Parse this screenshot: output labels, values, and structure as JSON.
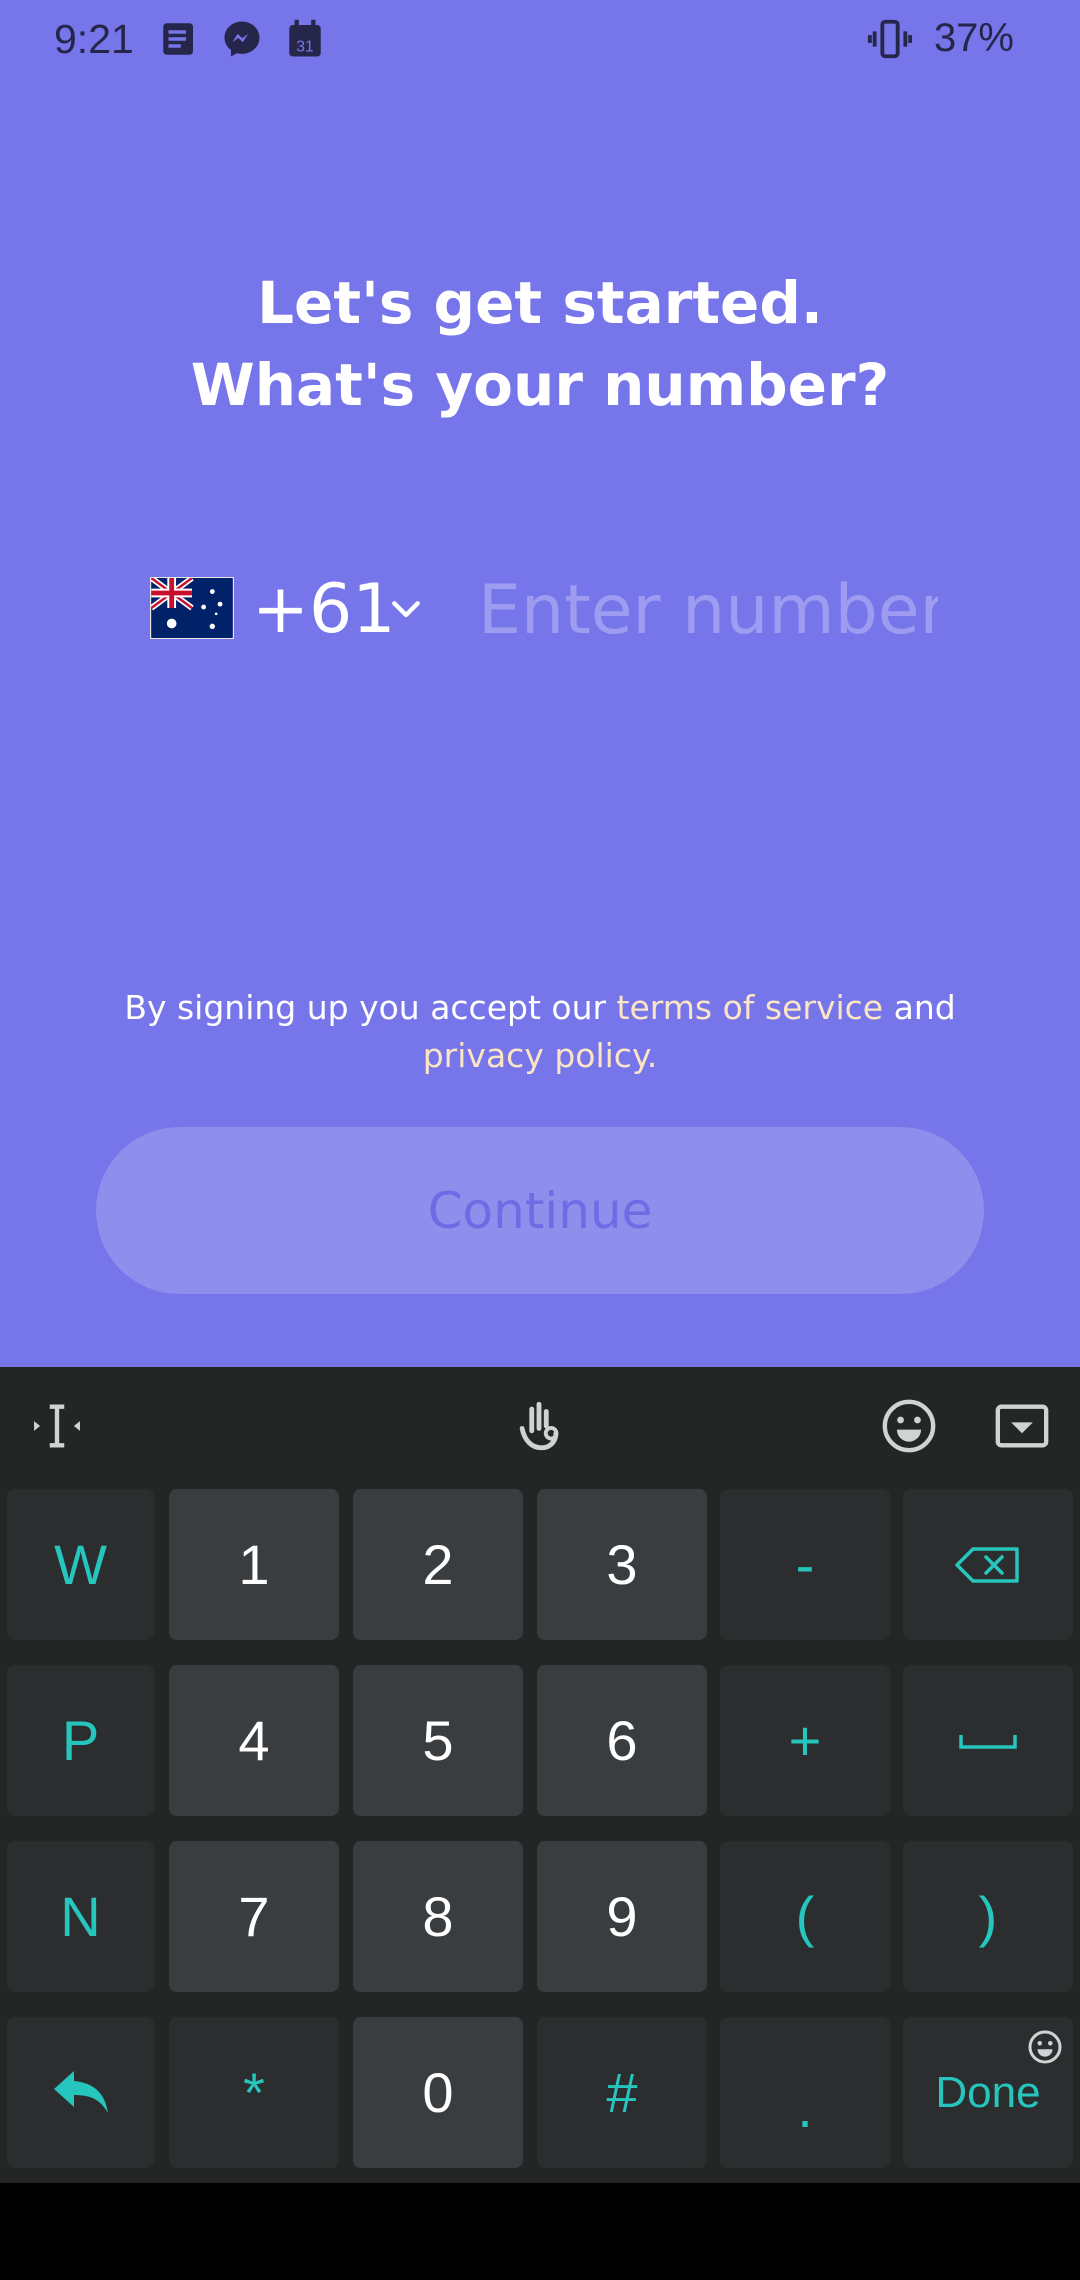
{
  "status_bar": {
    "time": "9:21",
    "battery": "37%",
    "icons": [
      "news-icon",
      "messenger-icon",
      "calendar-icon",
      "vibrate-icon"
    ],
    "calendar_day": "31"
  },
  "headline": {
    "line1": "Let's get started.",
    "line2": "What's your number?"
  },
  "phone": {
    "country_flag": "australia-flag",
    "country_code": "+61",
    "placeholder": "Enter number",
    "value": ""
  },
  "terms": {
    "prefix": "By signing up you accept our ",
    "tos_link": "terms of service",
    "middle": " and",
    "privacy_link": "privacy policy.",
    "link_color": "#fbe5c4"
  },
  "continue_button": {
    "label": "Continue",
    "enabled": false
  },
  "keyboard": {
    "accent_color": "#26c6bf",
    "toolbar": [
      "cursor-move-icon",
      "gesture-hand-icon",
      "emoji-icon",
      "hide-keyboard-icon"
    ],
    "rows": [
      [
        "W",
        "1",
        "2",
        "3",
        "-",
        "backspace"
      ],
      [
        "P",
        "4",
        "5",
        "6",
        "+",
        "space"
      ],
      [
        "N",
        "7",
        "8",
        "9",
        "(",
        ")"
      ],
      [
        "back-arrow",
        "*",
        "0",
        "#",
        ".",
        "Done"
      ]
    ],
    "keys": {
      "w": "W",
      "p": "P",
      "n": "N",
      "k1": "1",
      "k2": "2",
      "k3": "3",
      "k4": "4",
      "k5": "5",
      "k6": "6",
      "k7": "7",
      "k8": "8",
      "k9": "9",
      "k0": "0",
      "minus": "-",
      "plus": "+",
      "lparen": "(",
      "rparen": ")",
      "star": "*",
      "hash": "#",
      "dot": ".",
      "done": "Done"
    }
  },
  "colors": {
    "app_background": "#7775EA",
    "keyboard_background": "#242626"
  }
}
